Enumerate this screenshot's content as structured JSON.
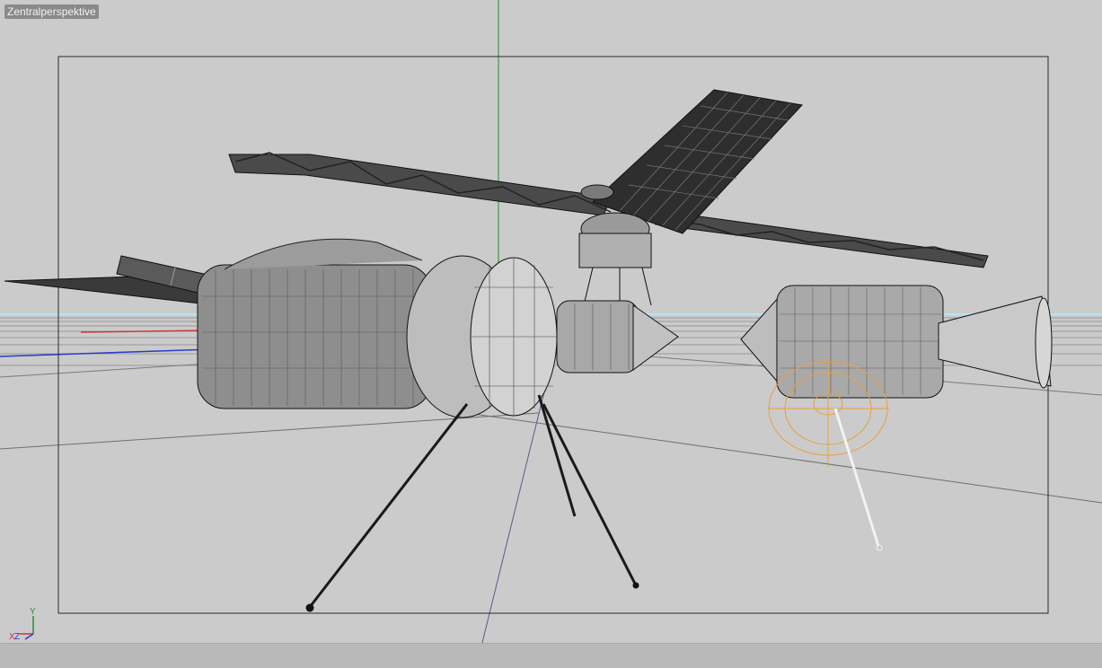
{
  "viewport": {
    "view_name": "Zentralperspektive",
    "axis_labels": {
      "x": "X",
      "y": "Y",
      "z": "Z"
    }
  },
  "colors": {
    "background": "#cbcbcb",
    "horizon": "#7ad0ff",
    "y_axis": "#2e8b2e",
    "x_axis": "#c83a3a",
    "z_axis": "#2a3ac8",
    "selection": "#e8a040"
  }
}
